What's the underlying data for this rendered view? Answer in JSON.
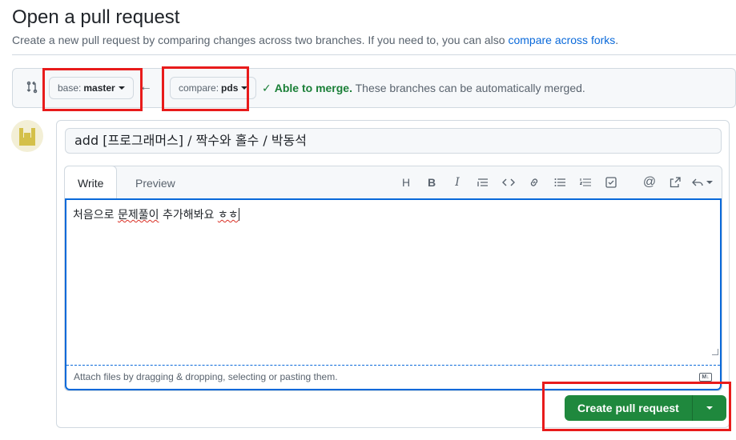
{
  "header": {
    "title": "Open a pull request",
    "subtitle_prefix": "Create a new pull request by comparing changes across two branches. If you need to, you can also",
    "subtitle_link": "compare across forks",
    "subtitle_suffix": "."
  },
  "compare": {
    "base_label": "base:",
    "base_branch": "master",
    "compare_label": "compare:",
    "compare_branch": "pds",
    "merge_status_strong": "Able to merge.",
    "merge_status_text": "These branches can be automatically merged."
  },
  "form": {
    "title_value": "add [프로그래머스] / 짝수와 홀수 / 박동석",
    "tabs": [
      "Write",
      "Preview"
    ],
    "body_before": "처음으로 ",
    "body_misspelled_1": "문제풀이",
    "body_middle": " 추가해봐요 ",
    "body_misspelled_2": "ㅎㅎ",
    "attach_hint": "Attach files by dragging & dropping, selecting or pasting them.",
    "markdown_badge": "M↓"
  },
  "toolbar": {
    "icons": [
      "heading-icon",
      "bold-icon",
      "italic-icon",
      "quote-icon",
      "code-icon",
      "link-icon",
      "unordered-list-icon",
      "ordered-list-icon",
      "task-list-icon",
      "mention-icon",
      "reference-icon",
      "reply-icon"
    ]
  },
  "actions": {
    "create_label": "Create pull request"
  },
  "colors": {
    "accent": "#0969da",
    "success": "#1a7f37",
    "button_green": "#1f883d",
    "annotation_red": "#e81b1b"
  }
}
